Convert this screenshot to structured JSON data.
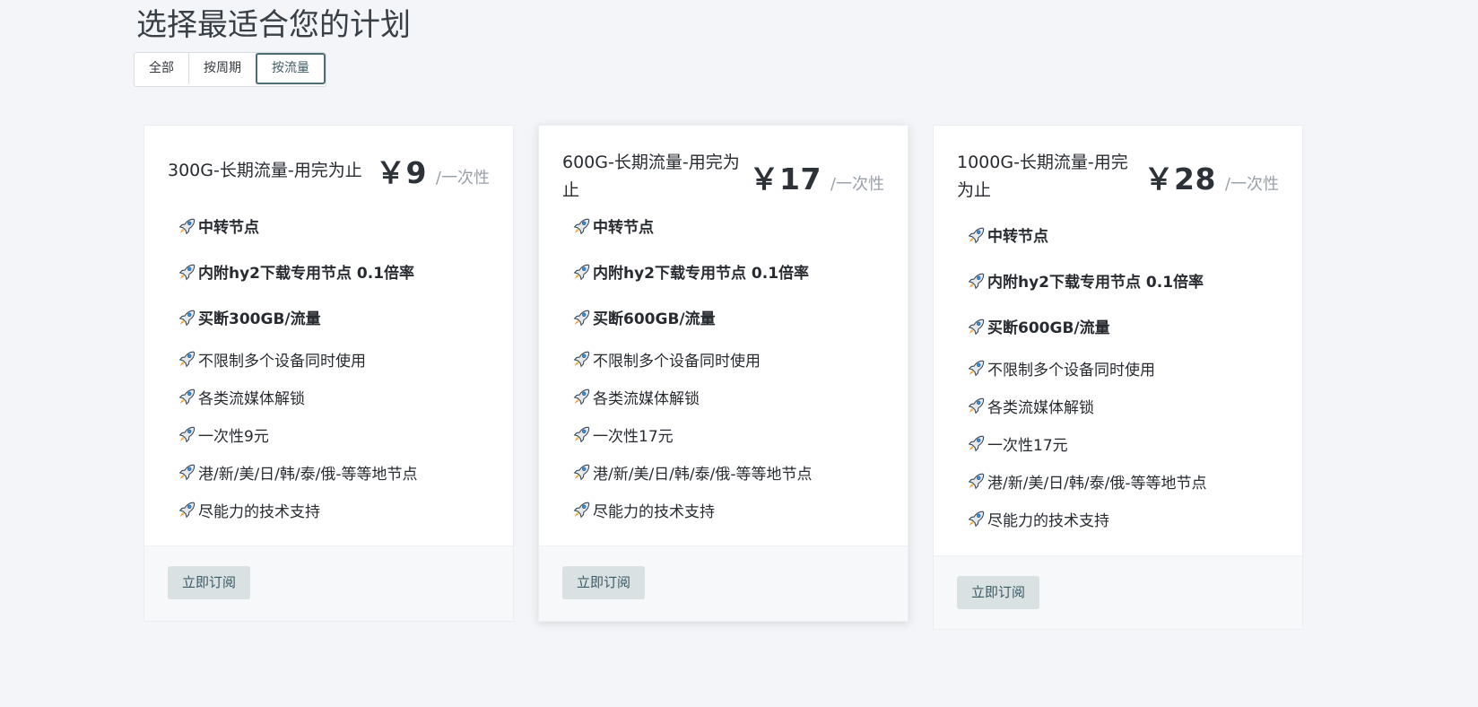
{
  "header": {
    "title": "选择最适合您的计划"
  },
  "filters": [
    {
      "label": "全部",
      "active": false
    },
    {
      "label": "按周期",
      "active": false
    },
    {
      "label": "按流量",
      "active": true
    }
  ],
  "plans": [
    {
      "name": "300G-长期流量-用完为止",
      "price": "￥9",
      "period": "/一次性",
      "features_bold": [
        "中转节点",
        "内附hy2下载专用节点 0.1倍率",
        "买断300GB/流量"
      ],
      "features": [
        "不限制多个设备同时使用",
        "各类流媒体解锁",
        "一次性9元",
        "港/新/美/日/韩/泰/俄-等等地节点",
        "尽能力的技术支持"
      ],
      "button": "立即订阅"
    },
    {
      "name": "600G-长期流量-用完为止",
      "price": "￥17",
      "period": "/一次性",
      "features_bold": [
        "中转节点",
        "内附hy2下载专用节点 0.1倍率",
        "买断600GB/流量"
      ],
      "features": [
        "不限制多个设备同时使用",
        "各类流媒体解锁",
        "一次性17元",
        "港/新/美/日/韩/泰/俄-等等地节点",
        "尽能力的技术支持"
      ],
      "button": "立即订阅"
    },
    {
      "name": "1000G-长期流量-用完为止",
      "price": "￥28",
      "period": "/一次性",
      "features_bold": [
        "中转节点",
        "内附hy2下载专用节点 0.1倍率",
        "买断600GB/流量"
      ],
      "features": [
        "不限制多个设备同时使用",
        "各类流媒体解锁",
        "一次性17元",
        "港/新/美/日/韩/泰/俄-等等地节点",
        "尽能力的技术支持"
      ],
      "button": "立即订阅"
    }
  ],
  "icons": {
    "feature": "rocket-icon"
  },
  "colors": {
    "accent": "#4d6e75",
    "button_bg": "#d9e1e3",
    "button_text": "#3c5a63",
    "page_bg": "#f3f5f8"
  }
}
